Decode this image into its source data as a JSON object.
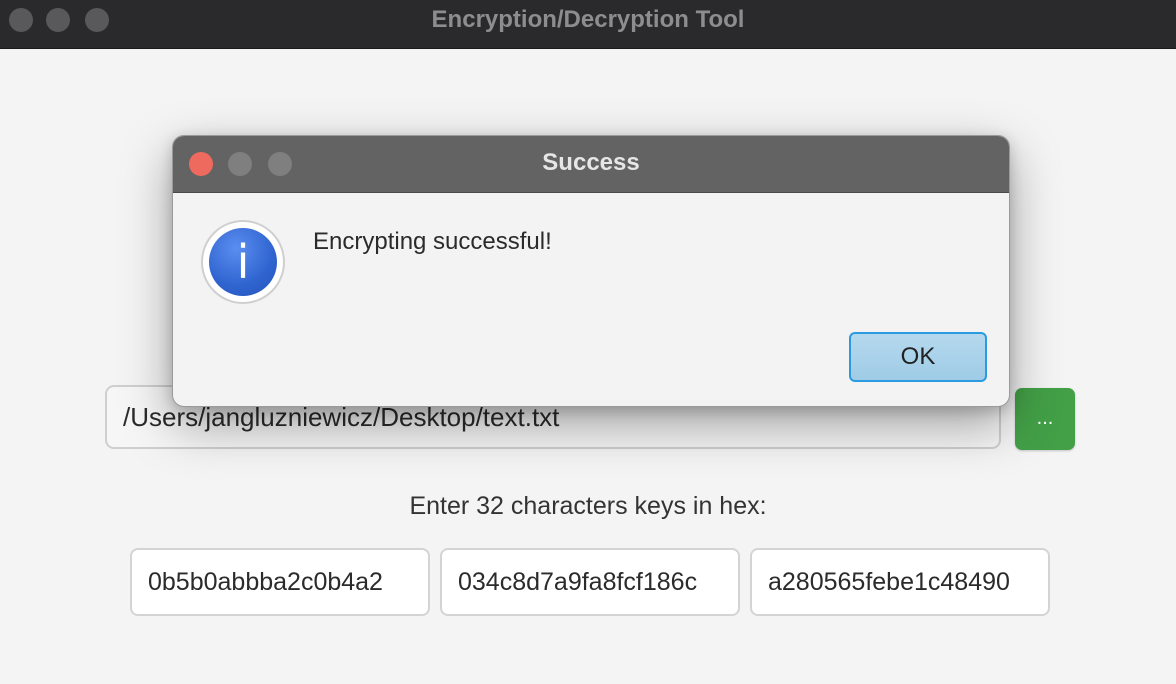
{
  "window": {
    "title": "Encryption/Decryption Tool"
  },
  "file": {
    "path": "/Users/jangluzniewicz/Desktop/text.txt",
    "browse_label": "..."
  },
  "keys": {
    "label": "Enter 32 characters keys in hex:",
    "values": [
      "0b5b0abbba2c0b4a2",
      "034c8d7a9fa8fcf186c",
      "a280565febe1c48490"
    ]
  },
  "dialog": {
    "title": "Success",
    "icon": "info-icon",
    "icon_glyph": "i",
    "message": "Encrypting successful!",
    "ok_label": "OK"
  },
  "colors": {
    "browse_button": "#43a047",
    "close_button": "#ee6a5e",
    "ok_border": "#2a9be0",
    "info_blue": "#2f64d0"
  }
}
